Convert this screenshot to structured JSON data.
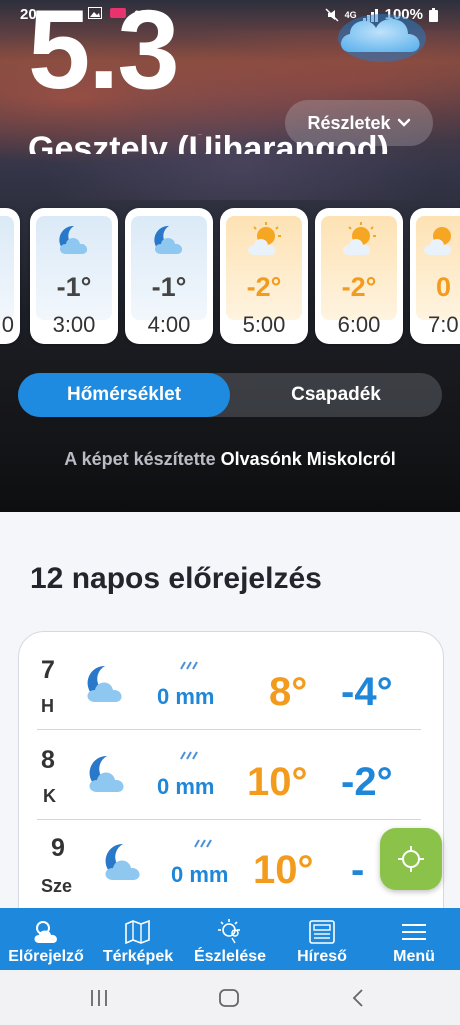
{
  "status_bar": {
    "time": "20",
    "battery": "100%",
    "network": "4G"
  },
  "current": {
    "temperature": "5.3",
    "location": "Gesztely (Újharangod)",
    "details_label": "Részletek"
  },
  "hourly": [
    {
      "temp": "",
      "time": "0",
      "kind": "night"
    },
    {
      "temp": "-1°",
      "time": "3:00",
      "kind": "night"
    },
    {
      "temp": "-1°",
      "time": "4:00",
      "kind": "night"
    },
    {
      "temp": "-2°",
      "time": "5:00",
      "kind": "day"
    },
    {
      "temp": "-2°",
      "time": "6:00",
      "kind": "day"
    },
    {
      "temp": "0",
      "time": "7:0",
      "kind": "day"
    }
  ],
  "toggle": {
    "active": "Hőmérséklet",
    "inactive": "Csapadék"
  },
  "credit": {
    "label": "A képet készítette",
    "author": "Olvasónk Miskolcról"
  },
  "forecast": {
    "title": "12 napos előrejelzés",
    "days": [
      {
        "day": "7",
        "abbr": "H",
        "precip": "0 mm",
        "max": "8°",
        "min": "-4°"
      },
      {
        "day": "8",
        "abbr": "K",
        "precip": "0 mm",
        "max": "10°",
        "min": "-2°"
      },
      {
        "day": "9",
        "abbr": "Sze",
        "precip": "0 mm",
        "max": "10°",
        "min": "-"
      }
    ]
  },
  "nav": [
    {
      "label": "Előrejelző",
      "icon": "weather-icon"
    },
    {
      "label": "Térképek",
      "icon": "map-icon"
    },
    {
      "label": "Észlelése",
      "icon": "observation-icon"
    },
    {
      "label": "Híreső",
      "icon": "news-icon"
    },
    {
      "label": "Menü",
      "icon": "menu-icon"
    }
  ],
  "colors": {
    "accent": "#1e88dc",
    "warm": "#f29b1d",
    "cold": "#1f86d8",
    "fab": "#8bc34a"
  }
}
